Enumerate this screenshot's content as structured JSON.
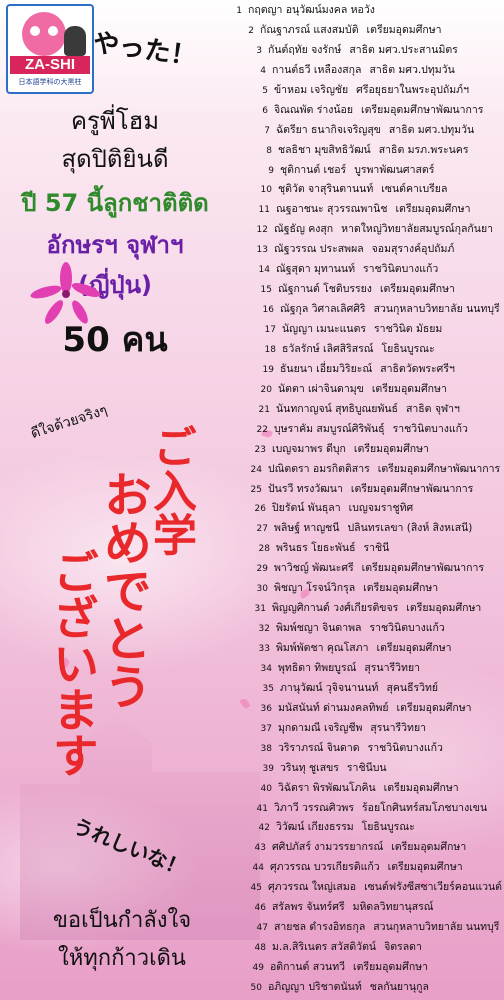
{
  "logo": {
    "title": "ZA-SHI",
    "subtitle": "日本語学科の大黒柱",
    "badge": "ภาษาญี่ปุ่น คุณซือเจ้"
  },
  "headline": {
    "yatta": "やった！",
    "line1": "ครูพี่โฮม",
    "line2": "สุดปิติยินดี",
    "line3": "ปี 57 นี้ลูกชาติติด",
    "line4": "อักษรฯ จุฬาฯ",
    "line5": "(ญี่ปุ่น)",
    "count": "50 คน"
  },
  "decor": {
    "dede": "ดีใจด้วยจริงๆ",
    "jp_col1": "ご入学",
    "jp_col2": "おめでとう",
    "jp_col3": "ございます",
    "ureshii": "うれしいな！",
    "cheer1": "ขอเป็นกำลังใจ",
    "cheer2": "ให้ทุกก้าวเดิน"
  },
  "colors": {
    "green": "#2e8a2a",
    "purple": "#6a1fa7",
    "red": "#e8282a",
    "pink": "#f06aa4"
  },
  "students": [
    {
      "num": "1",
      "name": "กฤตญา อนุวัฒน์มงคล หอวัง",
      "school": ""
    },
    {
      "num": "2",
      "name": "กัณฐาภรณ์ แสงสมบัติ",
      "school": "เตรียมอุดมศึกษา"
    },
    {
      "num": "3",
      "name": "กันต์ฤทัย จงรักษ์",
      "school": "สาธิต มศว.ประสานมิตร"
    },
    {
      "num": "4",
      "name": "กานต์ธวี เหลืองสกุล",
      "school": "สาธิต มศว.ปทุมวัน"
    },
    {
      "num": "5",
      "name": "ข้าหอม เจริญชัย",
      "school": "ศรีอยุธยาในพระอุปถัมภ์ฯ"
    },
    {
      "num": "6",
      "name": "จิณณพัต ร่างน้อย",
      "school": "เตรียมอุดมศึกษาพัฒนาการ"
    },
    {
      "num": "7",
      "name": "ฉัตรียา ธนากิจเจริญสุข",
      "school": "สาธิต มศว.ปทุมวัน"
    },
    {
      "num": "8",
      "name": "ชลธิชา มุขสิทธิวัฒน์",
      "school": "สาธิต มรภ.พระนคร"
    },
    {
      "num": "9",
      "name": "ชุติกานต์ เชอร์",
      "school": "บูรพาพัฒนศาสตร์"
    },
    {
      "num": "10",
      "name": "ชุติวัต จาสุรินตานนท์",
      "school": "เซนต์คาเบรียล"
    },
    {
      "num": "11",
      "name": "ณฐอาชนะ สุวรรณพานิช",
      "school": "เตรียมอุดมศึกษา"
    },
    {
      "num": "12",
      "name": "ณัฐธัญ คงสุก",
      "school": "หาดใหญ่วิทยาลัยสมบูรณ์กุลกันยา"
    },
    {
      "num": "13",
      "name": "ณัฐวรรณ ประสพผล",
      "school": "จอมสุรางค์อุปถัมภ์"
    },
    {
      "num": "14",
      "name": "ณัฐสุดา มุทานนท์",
      "school": "ราชวินิตบางแก้ว"
    },
    {
      "num": "15",
      "name": "ณัฐกานต์ โชติบรรยง",
      "school": "เตรียมอุดมศึกษา"
    },
    {
      "num": "16",
      "name": "ณัฐกุล วิศาลเลิศศิริ",
      "school": "สวนกุหลาบวิทยาลัย นนทบุรี"
    },
    {
      "num": "17",
      "name": "นัญญา เมนะแนตร",
      "school": "ราชวินิต มัธยม"
    },
    {
      "num": "18",
      "name": "ธวัลรักษ์ เลิศสิริสรณ์",
      "school": "โยธินบูรณะ"
    },
    {
      "num": "19",
      "name": "ธันยนา เอี่ยมวิริยะณ์",
      "school": "สาธิตวัดพระศรีฯ"
    },
    {
      "num": "20",
      "name": "นัตตา เผ่าจินดามุข",
      "school": "เตรียมอุดมศึกษา"
    },
    {
      "num": "21",
      "name": "นันทกาญจน์ สุทธิบูณยพันธ์",
      "school": "สาธิต จุฬาฯ"
    },
    {
      "num": "22",
      "name": "บุษราคัม สมบูรณ์ศิริพันธุ์",
      "school": "ราชวินิตบางแก้ว"
    },
    {
      "num": "23",
      "name": "เบญจมาพร ดีบุก",
      "school": "เตรียมอุดมศึกษา"
    },
    {
      "num": "24",
      "name": "ปณิตตรา อมรกิตติสาร",
      "school": "เตรียมอุดมศึกษาพัฒนาการ"
    },
    {
      "num": "25",
      "name": "ปันรวี ทรงวัฒนา",
      "school": "เตรียมอุดมศึกษาพัฒนาการ"
    },
    {
      "num": "26",
      "name": "ปิยรัตน์ พันธุลา",
      "school": "เบญจมราชูทิศ"
    },
    {
      "num": "27",
      "name": "พลิษฐ์ หาญชนี",
      "school": "ปลินทรเลขา (สิงห์ สิงหเสนี)"
    },
    {
      "num": "28",
      "name": "พรินธร โยธะพันธ์",
      "school": "ราชินี"
    },
    {
      "num": "29",
      "name": "พาวิชญ์ พัฒนะศรี",
      "school": "เตรียมอุดมศึกษาพัฒนาการ"
    },
    {
      "num": "30",
      "name": "พิชญา โรจน์วิกรุล",
      "school": "เตรียมอุดมศึกษา"
    },
    {
      "num": "31",
      "name": "พิญญศิกานต์ วงศ์เกียรติขจร",
      "school": "เตรียมอุดมศึกษา"
    },
    {
      "num": "32",
      "name": "พิมพ์ชญา จินดาพล",
      "school": "ราชวินิตบางแก้ว"
    },
    {
      "num": "33",
      "name": "พิมพ์พัตชา คุณโสภา",
      "school": "เตรียมอุดมศึกษา"
    },
    {
      "num": "34",
      "name": "พุทธิดา ทิพยบูรณ์",
      "school": "สุรนารีวิทยา"
    },
    {
      "num": "35",
      "name": "ภานุวัฒน์ วุจิจนานนท์",
      "school": "สุคนธีรวิทย์"
    },
    {
      "num": "36",
      "name": "มนัสนันท์ ด่านมงคลทิพย์",
      "school": "เตรียมอุดมศึกษา"
    },
    {
      "num": "37",
      "name": "มุกดามณี เจริญชีพ",
      "school": "สุรนารีวิทยา"
    },
    {
      "num": "38",
      "name": "วริราภรณ์ จินดาด",
      "school": "ราชวินิตบางแก้ว"
    },
    {
      "num": "39",
      "name": "วรินทุ ชูเสขร",
      "school": "ราชินีบน"
    },
    {
      "num": "40",
      "name": "วิฉัตรา พิรพัฒนโภคิน",
      "school": "เตรียมอุดมศึกษา"
    },
    {
      "num": "41",
      "name": "วิภาวี วรรณศิวพร",
      "school": "ร้อยโกศินทร์สมโภชบางเขน"
    },
    {
      "num": "42",
      "name": "วิวัฒน์ เกียงธรรม",
      "school": "โยธินบูรณะ"
    },
    {
      "num": "43",
      "name": "ศศิปภัสร์ งามวรรยากรณ์",
      "school": "เตรียมอุดมศึกษา"
    },
    {
      "num": "44",
      "name": "ศุภวรรณ บวรเกียรติแก้ว",
      "school": "เตรียมอุดมศึกษา"
    },
    {
      "num": "45",
      "name": "ศุภวรรณ ใหญ่เสมอ",
      "school": "เซนต์ฟรังซีสซาเวียร์คอนแวนต์"
    },
    {
      "num": "46",
      "name": "สรัลพร จันทร์ศรี",
      "school": "มหิดลวิทยานุสรณ์"
    },
    {
      "num": "47",
      "name": "สายชล ดำรงอิทธกุล",
      "school": "สวนกุหลาบวิทยาลัย นนทบุรี"
    },
    {
      "num": "48",
      "name": "ม.ล.สิริเนตร สวัสดิวัตน์",
      "school": "จิตรลดา"
    },
    {
      "num": "49",
      "name": "อติกานต์ สวนทวี",
      "school": "เตรียมอุดมศึกษา"
    },
    {
      "num": "50",
      "name": "อภิญญา ปริชาตนันท์",
      "school": "ชลกันยานุกูล"
    }
  ]
}
